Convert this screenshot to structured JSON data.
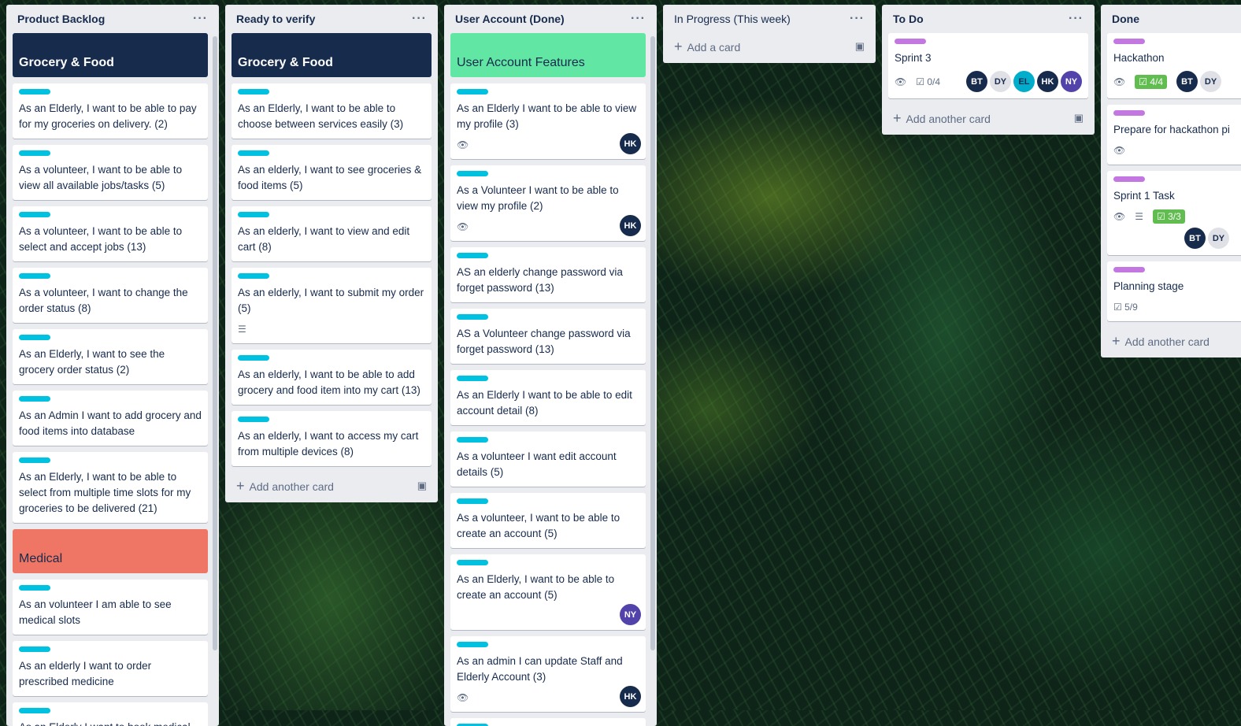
{
  "lists": {
    "backlog": {
      "title": "Product Backlog",
      "header_grocery": "Grocery & Food",
      "cards": [
        "As an Elderly, I want to be able to pay for my groceries on delivery. (2)",
        "As a volunteer, I want to be able to view all available jobs/tasks (5)",
        "As a volunteer, I want to be able to select and accept jobs (13)",
        "As a volunteer, I want to change the order status (8)",
        "As an Elderly, I want to see the grocery order status (2)",
        "As an Admin I want to add grocery and food items into database",
        "As an Elderly, I want to be able to select from multiple time slots for my groceries to be delivered (21)"
      ],
      "header_medical": "Medical",
      "medical_cards": [
        "As an volunteer I am able to see medical slots",
        "As an elderly I want to order prescribed medicine",
        "As an Elderly I want to book medical appointment"
      ]
    },
    "verify": {
      "title": "Ready to verify",
      "header_grocery": "Grocery & Food",
      "cards": [
        "As an Elderly, I want to be able to choose between services easily (3)",
        "As an elderly, I want to see groceries & food items (5)",
        "As an elderly, I want to view and edit cart (8)",
        "As an elderly, I want to submit my order (5)",
        "As an elderly, I want to be able to add grocery and food item into my cart (13)",
        "As an elderly, I want to access my cart from multiple devices (8)"
      ],
      "add_label": "Add another card"
    },
    "account": {
      "title": "User Account (Done)",
      "header": "User Account Features",
      "cards": [
        "As an Elderly I want to be able to view my profile (3)",
        "As a Volunteer I want to be able to view my profile (2)",
        "AS an elderly change password via forget password (13)",
        "AS a Volunteer change password via forget password (13)",
        "As an Elderly I want to be able to edit account detail (8)",
        "As a volunteer I want edit account details (5)",
        "As a volunteer, I want to be able to create an account (5)",
        "As an Elderly, I want to be able to create an account (5)",
        "As an admin I can update Staff and Elderly Account (3)"
      ],
      "avatars": [
        "HK",
        "HK",
        "NY",
        "HK"
      ]
    },
    "inprogress": {
      "title": "In Progress (This week)",
      "add_label": "Add a card"
    },
    "todo": {
      "title": "To Do",
      "card_title": "Sprint 3",
      "checklist": "0/4",
      "avatars": [
        "BT",
        "DY",
        "EL",
        "HK",
        "NY"
      ],
      "add_label": "Add another card"
    },
    "done": {
      "title": "Done",
      "cards": [
        {
          "title": "Hackathon",
          "checklist": "4/4",
          "avatars": [
            "BT",
            "DY"
          ]
        },
        {
          "title": "Prepare for hackathon pi"
        },
        {
          "title": "Sprint 1 Task",
          "checklist": "3/3",
          "avatars": [
            "BT",
            "DY"
          ]
        },
        {
          "title": "Planning stage",
          "checklist": "5/9"
        }
      ],
      "add_label": "Add another card"
    }
  },
  "colors": {
    "label_cyan": "#00c2e0",
    "label_purple": "#c377e0",
    "header_dark": "#172b4d",
    "header_green": "#61e6a4",
    "header_red": "#ef7564",
    "list_bg": "#ebecf0"
  }
}
